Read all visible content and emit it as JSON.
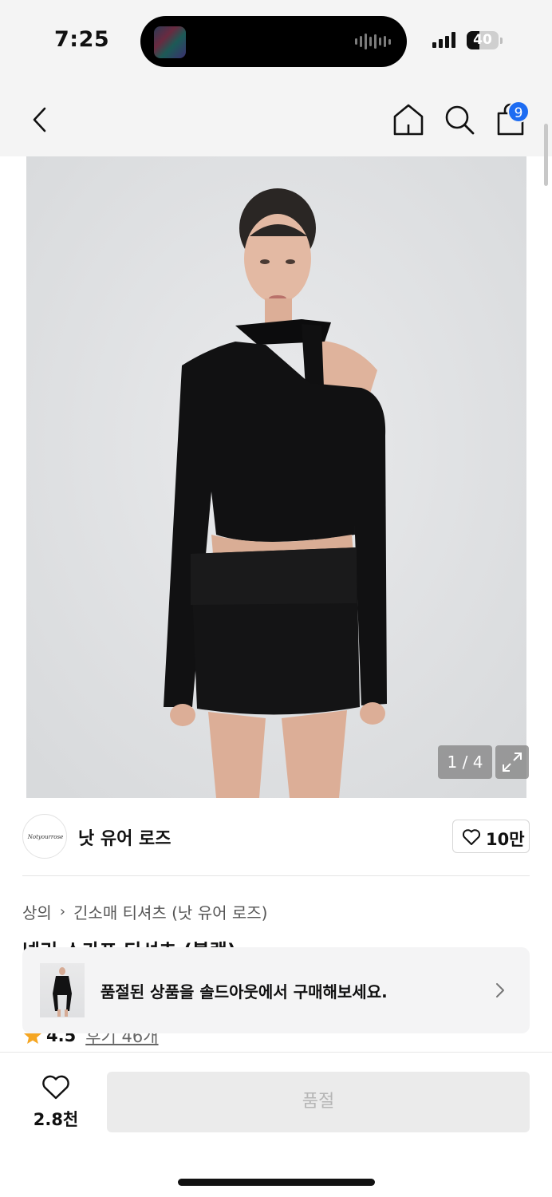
{
  "status_bar": {
    "time": "7:25",
    "battery": "40",
    "battery_level": 0.4,
    "signal_bars": 4
  },
  "nav": {
    "cart_count": "9",
    "icons": [
      "chevron-left-icon",
      "home-icon",
      "search-icon",
      "shopping-bag-icon"
    ]
  },
  "gallery": {
    "counter": "1 / 4",
    "current": 1,
    "total": 4
  },
  "brand": {
    "name": "낫 유어 로즈",
    "logo_text": "Notyourrose",
    "likes": "10만"
  },
  "breadcrumb": {
    "category": "상의",
    "subcategory": "긴소매 티셔츠 (낫 유어 로즈)"
  },
  "product": {
    "title": "넥리 스카프 티셔츠 (블랙)"
  },
  "soldout_banner": {
    "text": "품절된 상품을 솔드아웃에서 구매해보세요."
  },
  "rating": {
    "value": "4.5",
    "reviews": "후기 46개"
  },
  "bottom_bar": {
    "wish_count": "2.8천",
    "buy_label": "품절"
  },
  "colors": {
    "accent_blue": "#1d6cf2",
    "star": "#f5a623",
    "disabled_bg": "#ebebeb",
    "disabled_text": "#b5b5b5"
  }
}
